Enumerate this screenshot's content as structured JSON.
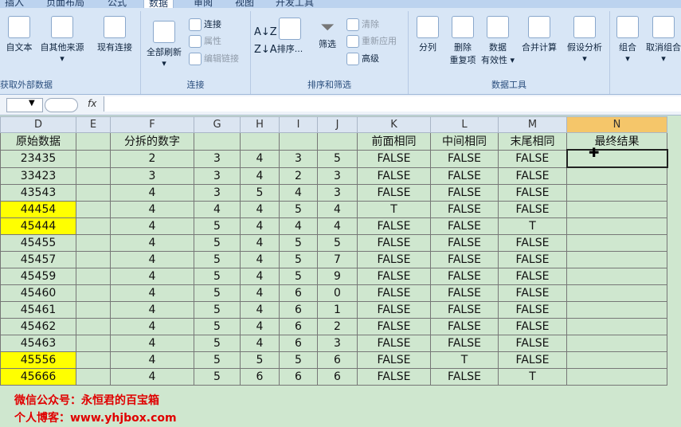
{
  "tabs": [
    "插入",
    "页面布局",
    "公式",
    "数据",
    "审阅",
    "视图",
    "开发工具"
  ],
  "active_tab": "数据",
  "groups": {
    "external": {
      "label": "获取外部数据",
      "from_text": "自文本",
      "other_sources": "自其他来源",
      "existing": "现有连接"
    },
    "connections": {
      "label": "连接",
      "refresh_all": "全部刷新",
      "connect": "连接",
      "props": "属性",
      "edit_links": "编辑链接"
    },
    "sort": {
      "label": "排序和筛选",
      "sort": "排序...",
      "filter": "筛选",
      "clear": "清除",
      "reapply": "重新应用",
      "advanced": "高级"
    },
    "tools": {
      "label": "数据工具",
      "split": "分列",
      "remove_dup_1": "删除",
      "remove_dup_2": "重复项",
      "validate_1": "数据",
      "validate_2": "有效性",
      "consolidate": "合并计算",
      "whatif": "假设分析"
    },
    "outline": {
      "group": "组合",
      "ungroup": "取消组合"
    }
  },
  "namebox": "",
  "fx": "fx",
  "columns": [
    "D",
    "E",
    "F",
    "G",
    "H",
    "I",
    "J",
    "K",
    "L",
    "M",
    "N"
  ],
  "selected_column": "N",
  "header_row": [
    "原始数据",
    "",
    "分拆的数字",
    "",
    "",
    "",
    "",
    "前面相同",
    "中间相同",
    "末尾相同",
    "最终结果"
  ],
  "rows": [
    {
      "d": "23435",
      "f": "2",
      "g": "3",
      "h": "4",
      "i": "3",
      "j": "5",
      "k": "FALSE",
      "l": "FALSE",
      "m": "FALSE",
      "hl": false
    },
    {
      "d": "33423",
      "f": "3",
      "g": "3",
      "h": "4",
      "i": "2",
      "j": "3",
      "k": "FALSE",
      "l": "FALSE",
      "m": "FALSE",
      "hl": false
    },
    {
      "d": "43543",
      "f": "4",
      "g": "3",
      "h": "5",
      "i": "4",
      "j": "3",
      "k": "FALSE",
      "l": "FALSE",
      "m": "FALSE",
      "hl": false
    },
    {
      "d": "44454",
      "f": "4",
      "g": "4",
      "h": "4",
      "i": "5",
      "j": "4",
      "k": "T",
      "l": "FALSE",
      "m": "FALSE",
      "hl": true
    },
    {
      "d": "45444",
      "f": "4",
      "g": "5",
      "h": "4",
      "i": "4",
      "j": "4",
      "k": "FALSE",
      "l": "FALSE",
      "m": "T",
      "hl": true
    },
    {
      "d": "45455",
      "f": "4",
      "g": "5",
      "h": "4",
      "i": "5",
      "j": "5",
      "k": "FALSE",
      "l": "FALSE",
      "m": "FALSE",
      "hl": false
    },
    {
      "d": "45457",
      "f": "4",
      "g": "5",
      "h": "4",
      "i": "5",
      "j": "7",
      "k": "FALSE",
      "l": "FALSE",
      "m": "FALSE",
      "hl": false
    },
    {
      "d": "45459",
      "f": "4",
      "g": "5",
      "h": "4",
      "i": "5",
      "j": "9",
      "k": "FALSE",
      "l": "FALSE",
      "m": "FALSE",
      "hl": false
    },
    {
      "d": "45460",
      "f": "4",
      "g": "5",
      "h": "4",
      "i": "6",
      "j": "0",
      "k": "FALSE",
      "l": "FALSE",
      "m": "FALSE",
      "hl": false
    },
    {
      "d": "45461",
      "f": "4",
      "g": "5",
      "h": "4",
      "i": "6",
      "j": "1",
      "k": "FALSE",
      "l": "FALSE",
      "m": "FALSE",
      "hl": false
    },
    {
      "d": "45462",
      "f": "4",
      "g": "5",
      "h": "4",
      "i": "6",
      "j": "2",
      "k": "FALSE",
      "l": "FALSE",
      "m": "FALSE",
      "hl": false
    },
    {
      "d": "45463",
      "f": "4",
      "g": "5",
      "h": "4",
      "i": "6",
      "j": "3",
      "k": "FALSE",
      "l": "FALSE",
      "m": "FALSE",
      "hl": false
    },
    {
      "d": "45556",
      "f": "4",
      "g": "5",
      "h": "5",
      "i": "5",
      "j": "6",
      "k": "FALSE",
      "l": "T",
      "m": "FALSE",
      "hl": true
    },
    {
      "d": "45666",
      "f": "4",
      "g": "5",
      "h": "6",
      "i": "6",
      "j": "6",
      "k": "FALSE",
      "l": "FALSE",
      "m": "T",
      "hl": true
    }
  ],
  "footer": {
    "line1": "微信公众号：永恒君的百宝箱",
    "line2": "个人博客：www.yhjbox.com"
  },
  "colors": {
    "highlight": "#ffff00",
    "footer": "#e00000",
    "selected_header": "#f5c66a"
  }
}
